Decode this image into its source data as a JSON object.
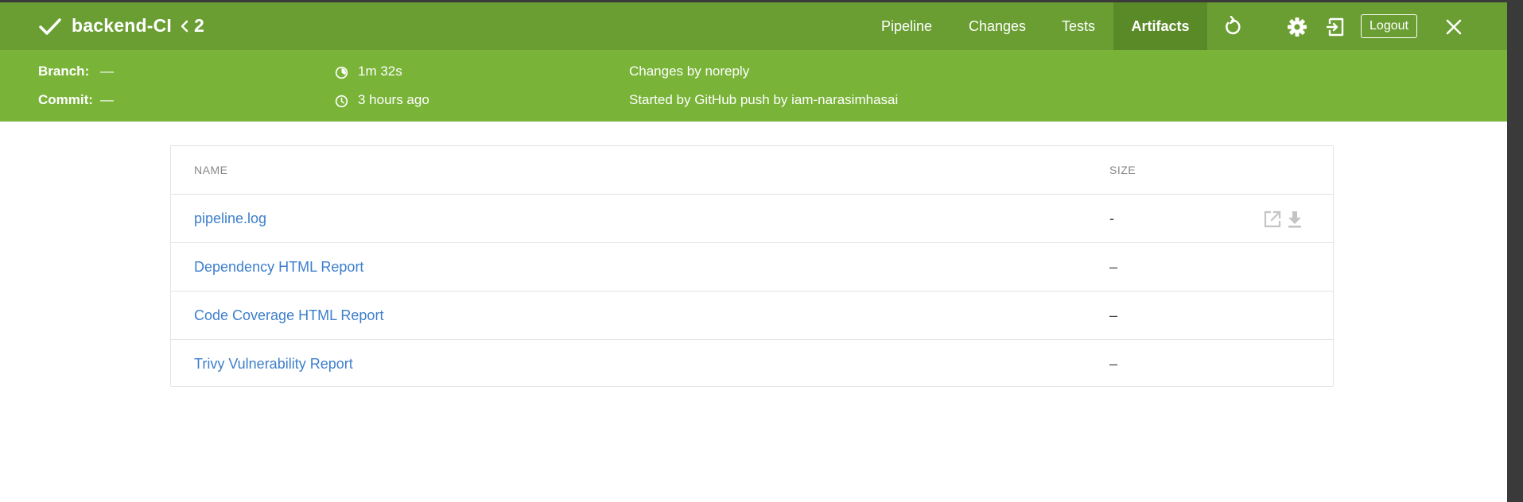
{
  "header": {
    "title": "backend-CI",
    "run_number": "2",
    "tabs": [
      {
        "label": "Pipeline",
        "active": false
      },
      {
        "label": "Changes",
        "active": false
      },
      {
        "label": "Tests",
        "active": false
      },
      {
        "label": "Artifacts",
        "active": true
      }
    ],
    "logout_label": "Logout",
    "icons": [
      "check-icon",
      "chevron-left-icon",
      "rerun-icon",
      "gear-icon",
      "exit-icon",
      "close-icon"
    ]
  },
  "run_info": {
    "branch_label": "Branch:",
    "branch_value": "—",
    "commit_label": "Commit:",
    "commit_value": "—",
    "duration": "1m 32s",
    "time_ago": "3 hours ago",
    "changes": "Changes by noreply",
    "started_by": "Started by GitHub push by iam-narasimhasai"
  },
  "artifacts": {
    "columns": {
      "name": "NAME",
      "size": "SIZE"
    },
    "rows": [
      {
        "name": "pipeline.log",
        "size": "-"
      },
      {
        "name": "Dependency HTML Report",
        "size": "–"
      },
      {
        "name": "Code Coverage HTML Report",
        "size": "–"
      },
      {
        "name": "Trivy Vulnerability Report",
        "size": "–"
      }
    ]
  },
  "colors": {
    "header_bg": "#6a9e32",
    "active_tab_bg": "#5a8a28",
    "subheader_bg": "#79b338",
    "link": "#3d7fcc"
  }
}
